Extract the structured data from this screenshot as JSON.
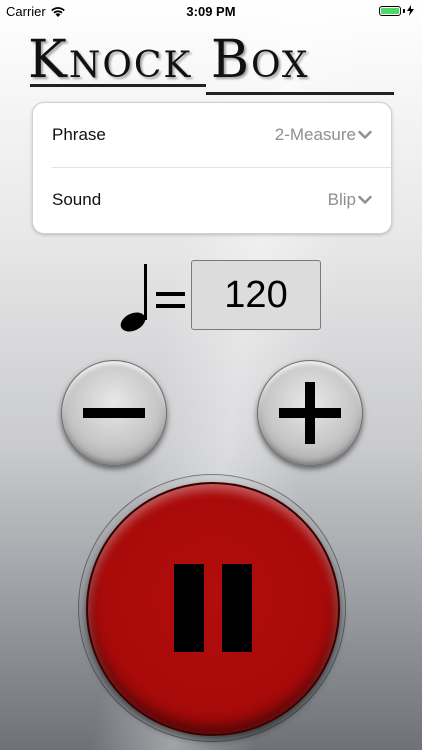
{
  "status_bar": {
    "carrier": "Carrier",
    "time": "3:09 PM",
    "battery_color": "#4cd964"
  },
  "logo": {
    "text": "Knock Box"
  },
  "settings": {
    "rows": [
      {
        "label": "Phrase",
        "value": "2-Measure",
        "icon": "chevron-down-icon"
      },
      {
        "label": "Sound",
        "value": "Blip",
        "icon": "chevron-down-icon"
      }
    ]
  },
  "tempo": {
    "note_icon": "quarter-note-icon",
    "value": "120"
  },
  "controls": {
    "decrement_icon": "minus-icon",
    "increment_icon": "plus-icon",
    "transport_icon": "pause-icon",
    "transport_color": "#b00c0c"
  }
}
